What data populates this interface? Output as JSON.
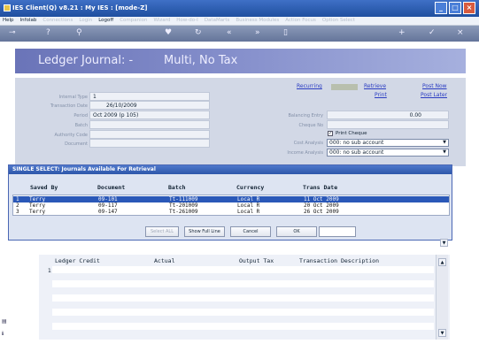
{
  "window": {
    "title": "IES Client(Q) v8.21 : My IES :      [mode-Z]"
  },
  "menu": {
    "items": [
      {
        "label": "Help",
        "enabled": true
      },
      {
        "label": "Infolab",
        "enabled": true
      },
      {
        "label": "Connections",
        "enabled": false
      },
      {
        "label": "Login",
        "enabled": false
      },
      {
        "label": "Logoff",
        "enabled": true
      },
      {
        "label": "Companion",
        "enabled": false
      },
      {
        "label": "Wizard",
        "enabled": false
      },
      {
        "label": "How-do-I",
        "enabled": false
      },
      {
        "label": "DataMarts",
        "enabled": false
      },
      {
        "label": "Business Modules",
        "enabled": false
      },
      {
        "label": "Action Focus",
        "enabled": false
      },
      {
        "label": "Option Select",
        "enabled": false
      }
    ]
  },
  "toolbar": {
    "icons": [
      "key-icon",
      "help-icon",
      "search-icon",
      "heart-icon",
      "refresh-icon",
      "back-icon",
      "forward-icon",
      "clipboard-icon",
      "add-icon",
      "check-icon",
      "close-icon"
    ]
  },
  "header": {
    "title": "Ledger Journal: -",
    "mode": "Multi, No Tax"
  },
  "form": {
    "labels": {
      "internal_type": "Internal Type",
      "transaction_date": "Transaction Date",
      "period": "Period",
      "batch": "Batch",
      "authority_code": "Authority Code",
      "document": "Document",
      "balancing_entry": "Balancing Entry",
      "cheque_no": "Cheque No",
      "cost_analysis": "Cost Analysis",
      "income_analysis": "Income Analysis"
    },
    "internal_type": "1",
    "transaction_date": "26/10/2009",
    "period": "Oct 2009 (p 105)",
    "batch": "",
    "authority_code": "",
    "document": "",
    "balancing_entry": "0.00",
    "cheque_no": "",
    "print_cheque_label": "Print Cheque",
    "print_cheque_checked": true,
    "cost_analysis": "000: no sub account",
    "income_analysis": "000: no sub account"
  },
  "links": {
    "recurring": "Recurring",
    "retrieve": "Retrieve",
    "print": "Print",
    "post_now": "Post Now",
    "post_later": "Post Later"
  },
  "dialog": {
    "title": "SINGLE SELECT: Journals Available For Retrieval",
    "columns": [
      "Saved By",
      "Document",
      "Batch",
      "Currency",
      "Trans Date"
    ],
    "rows": [
      {
        "num": "1",
        "saved_by": "Terry",
        "document": "09-101",
        "batch": "Tt-111009",
        "currency": "Local R",
        "trans_date": "11 Oct 2009",
        "selected": true
      },
      {
        "num": "2",
        "saved_by": "Terry",
        "document": "09-117",
        "batch": "Tt-201009",
        "currency": "Local R",
        "trans_date": "20 Oct 2009",
        "selected": false
      },
      {
        "num": "3",
        "saved_by": "Terry",
        "document": "09-147",
        "batch": "Tt-261009",
        "currency": "Local R",
        "trans_date": "26 Oct 2009",
        "selected": false
      }
    ],
    "buttons": {
      "select_all": "Select ALL",
      "show_full_line": "Show Full Line",
      "cancel": "Cancel",
      "ok": "OK"
    },
    "search_value": ""
  },
  "lower_grid": {
    "columns": [
      "Ledger Credit",
      "Actual",
      "Output Tax",
      "Transaction Description"
    ],
    "first_row_num": "1"
  },
  "colors": {
    "title_bar": "#2a5bb0",
    "header_banner": "#7c86c6",
    "selected_row": "#2a58b8",
    "link": "#2a3cc2"
  }
}
